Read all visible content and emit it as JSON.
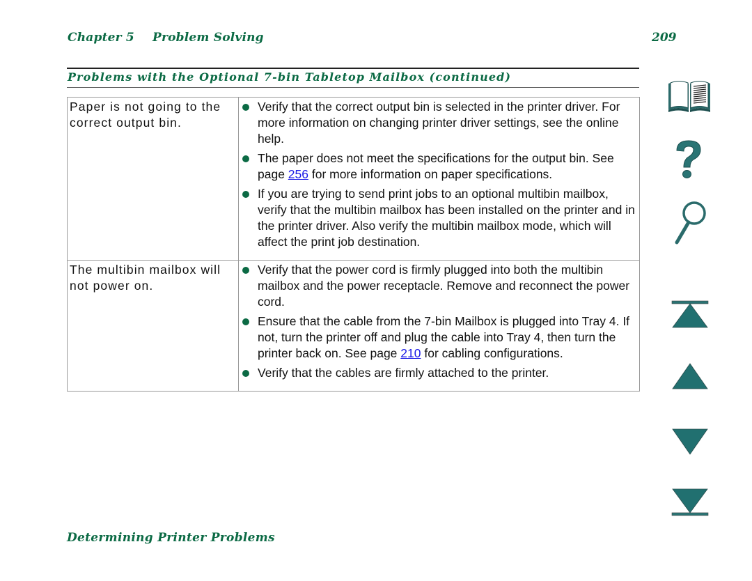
{
  "header": {
    "chapter": "Chapter 5",
    "chapter_title": "Problem Solving",
    "page_number": "209"
  },
  "section_title": "Problems with the Optional 7-bin Tabletop Mailbox (continued)",
  "rows": [
    {
      "problem": "Paper is not going to the correct output bin.",
      "solutions": [
        {
          "before": "Verify that the correct output bin is selected in the printer driver. For more information on changing printer driver settings, see the online help.",
          "link": "",
          "after": ""
        },
        {
          "before": "The paper does not meet the specifications for the output bin. See page ",
          "link": "256",
          "after": " for more information on paper specifications."
        },
        {
          "before": "If you are trying to send print jobs to an optional multibin mailbox, verify that the multibin mailbox has been installed on the printer and in the printer driver. Also verify the multibin mailbox mode, which will affect the print job destination.",
          "link": "",
          "after": ""
        }
      ]
    },
    {
      "problem": "The multibin mailbox will not power on.",
      "solutions": [
        {
          "before": "Verify that the power cord is firmly plugged into both the multibin mailbox and the power receptacle. Remove and reconnect the power cord.",
          "link": "",
          "after": ""
        },
        {
          "before": "Ensure that the cable from the 7-bin Mailbox is plugged into Tray 4. If not, turn the printer off and plug the cable into Tray 4, then turn the printer back on. See page ",
          "link": "210",
          "after": " for cabling configurations."
        },
        {
          "before": "Verify that the cables are firmly attached to the printer.",
          "link": "",
          "after": ""
        }
      ]
    }
  ],
  "footer": "Determining Printer Problems",
  "nav": {
    "icons": [
      "book-icon",
      "help-icon",
      "search-icon",
      "first-page-icon",
      "previous-page-icon",
      "next-page-icon",
      "last-page-icon"
    ]
  },
  "colors": {
    "accent_green": "#0b6a44",
    "icon_teal": "#1f6f6f",
    "link_blue": "#1a1ae6"
  }
}
